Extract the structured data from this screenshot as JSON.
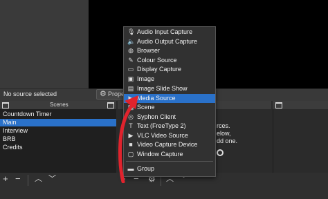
{
  "source_bar": {
    "status": "No source selected",
    "properties_label": "Prope"
  },
  "scenes": {
    "title": "Scenes",
    "items": [
      "Countdown Timer",
      "Main",
      "Interview",
      "BRB",
      "Credits"
    ],
    "selected_index": 1
  },
  "sources": {
    "hint_lines": [
      "rces.",
      "elow,",
      "dd one."
    ]
  },
  "menu": {
    "items": [
      {
        "label": "Audio Input Capture",
        "icon": "microphone-icon"
      },
      {
        "label": "Audio Output Capture",
        "icon": "speaker-icon"
      },
      {
        "label": "Browser",
        "icon": "globe-icon"
      },
      {
        "label": "Colour Source",
        "icon": "paint-brush-icon"
      },
      {
        "label": "Display Capture",
        "icon": "monitor-icon"
      },
      {
        "label": "Image",
        "icon": "image-icon"
      },
      {
        "label": "Image Slide Show",
        "icon": "slideshow-icon"
      },
      {
        "label": "Media Source",
        "icon": "play-icon"
      },
      {
        "label": "Scene",
        "icon": "scene-icon"
      },
      {
        "label": "Syphon Client",
        "icon": "syphon-icon"
      },
      {
        "label": "Text (FreeType 2)",
        "icon": "text-icon"
      },
      {
        "label": "VLC Video Source",
        "icon": "play-icon"
      },
      {
        "label": "Video Capture Device",
        "icon": "camera-icon"
      },
      {
        "label": "Window Capture",
        "icon": "window-icon"
      },
      {
        "label": "Group",
        "icon": "folder-icon"
      }
    ],
    "selected_index": 7
  },
  "colors": {
    "selection": "#2a71c9",
    "arrow": "#e0232d"
  }
}
